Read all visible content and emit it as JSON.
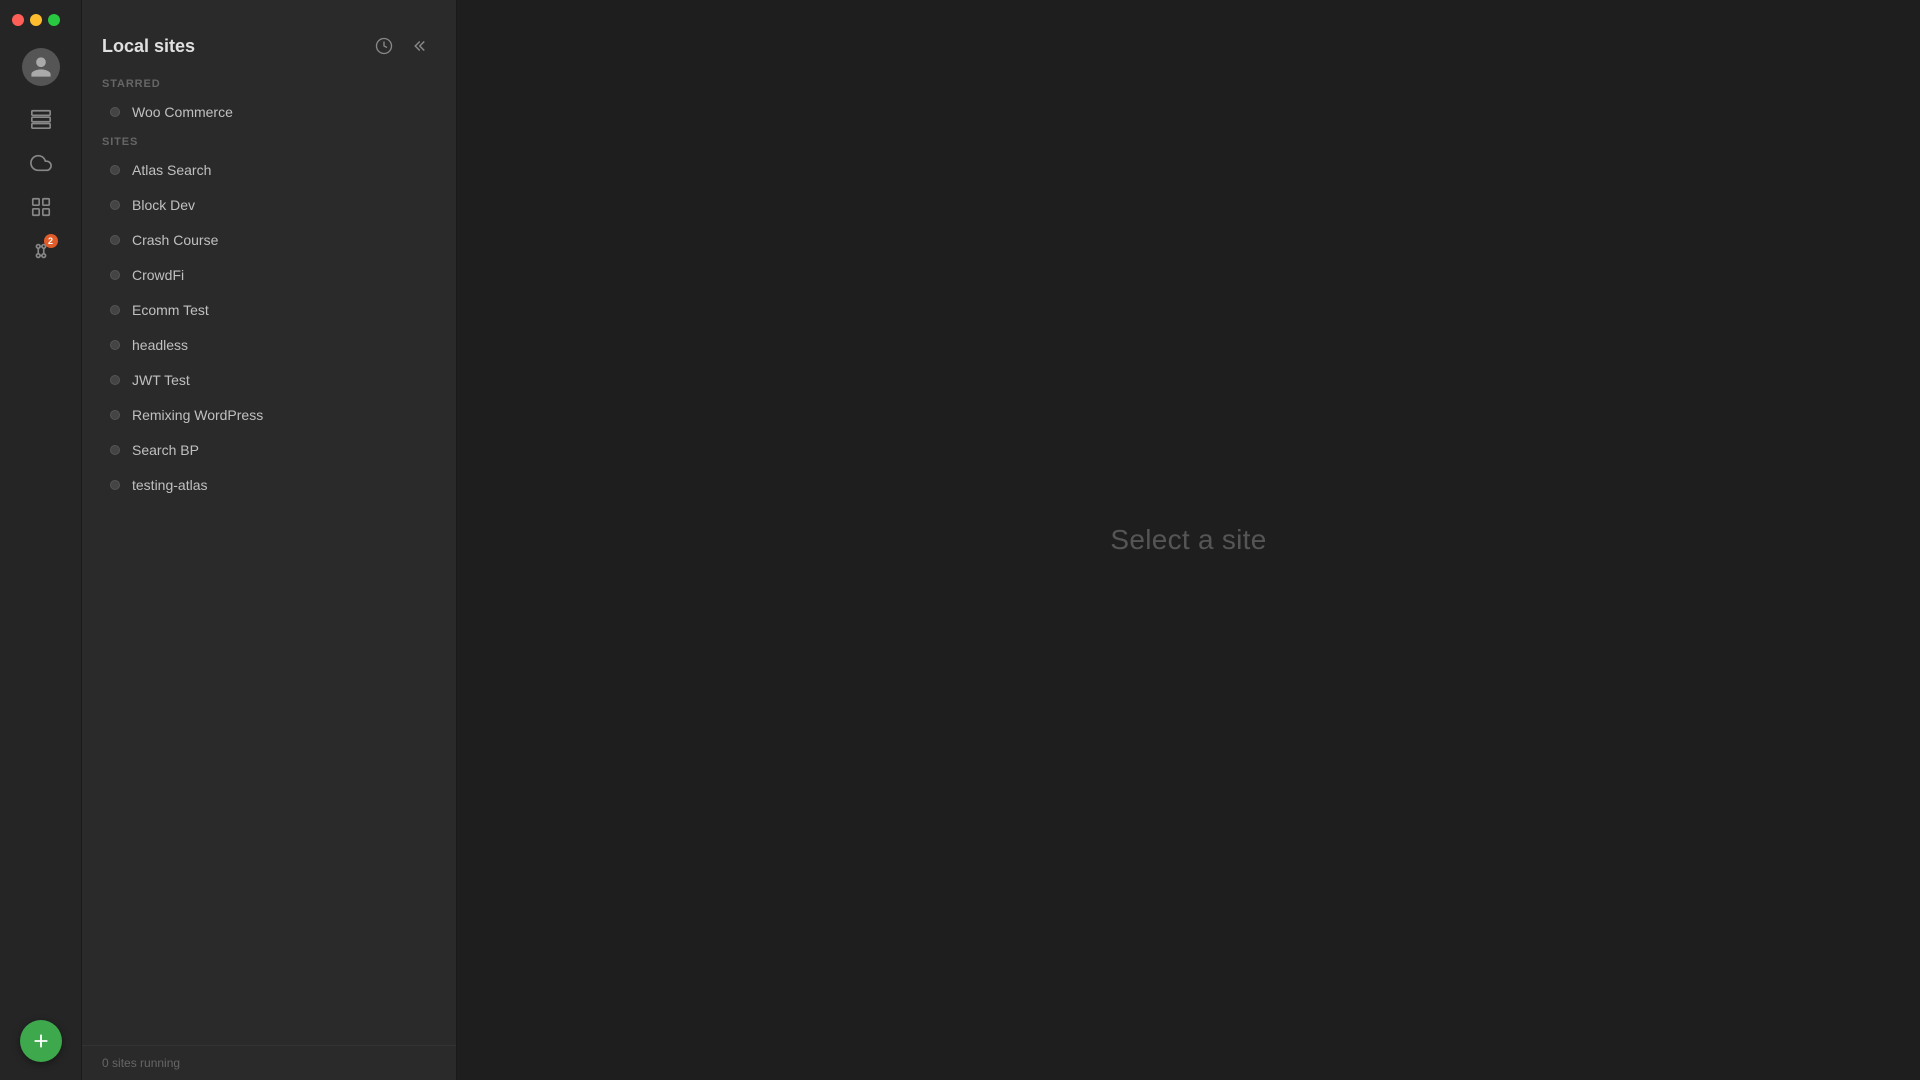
{
  "window": {
    "traffic_lights": [
      "red",
      "yellow",
      "green"
    ]
  },
  "sidebar": {
    "icons": [
      {
        "name": "stack-icon",
        "label": "Sites"
      },
      {
        "name": "cloud-icon",
        "label": "Cloud"
      },
      {
        "name": "grid-icon",
        "label": "Add-ons"
      },
      {
        "name": "extensions-icon",
        "label": "Extensions",
        "badge": "2"
      }
    ],
    "help_label": "?",
    "add_label": "+"
  },
  "sites_panel": {
    "title": "Local sites",
    "starred_label": "Starred",
    "sites_label": "Sites",
    "starred_sites": [
      {
        "name": "Woo Commerce",
        "running": false
      }
    ],
    "sites": [
      {
        "name": "Atlas Search",
        "running": false
      },
      {
        "name": "Block Dev",
        "running": false
      },
      {
        "name": "Crash Course",
        "running": false
      },
      {
        "name": "CrowdFi",
        "running": false
      },
      {
        "name": "Ecomm Test",
        "running": false
      },
      {
        "name": "headless",
        "running": false
      },
      {
        "name": "JWT Test",
        "running": false
      },
      {
        "name": "Remixing WordPress",
        "running": false
      },
      {
        "name": "Search BP",
        "running": false
      },
      {
        "name": "testing-atlas",
        "running": false
      }
    ],
    "footer": {
      "running_count": "0",
      "running_label": "sites running"
    }
  },
  "main": {
    "placeholder_text": "Select a site"
  }
}
